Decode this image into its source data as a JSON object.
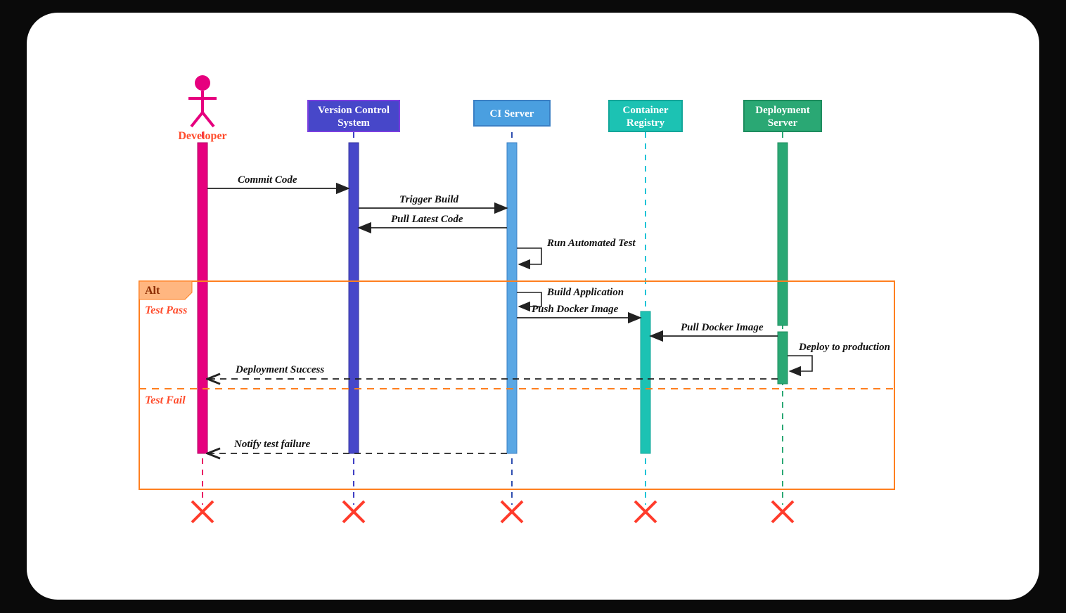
{
  "actor": {
    "name": "Developer"
  },
  "participants": {
    "vcs": {
      "label1": "Version Control",
      "label2": "System"
    },
    "ci": {
      "label1": "CI Server"
    },
    "reg": {
      "label1": "Container",
      "label2": "Registry"
    },
    "dep": {
      "label1": "Deployment",
      "label2": "Server"
    }
  },
  "alt": {
    "title": "Alt",
    "case1": "Test Pass",
    "case2": "Test Fail"
  },
  "messages": {
    "commit": "Commit Code",
    "trigger": "Trigger Build",
    "pullcode": "Pull Latest Code",
    "runtest": "Run Automated Test",
    "buildapp": "Build Application",
    "pushimg": "Push Docker Image",
    "pullimg": "Pull Docker Image",
    "deploy": "Deploy to production",
    "success": "Deployment Success",
    "failnote": "Notify test failure"
  }
}
